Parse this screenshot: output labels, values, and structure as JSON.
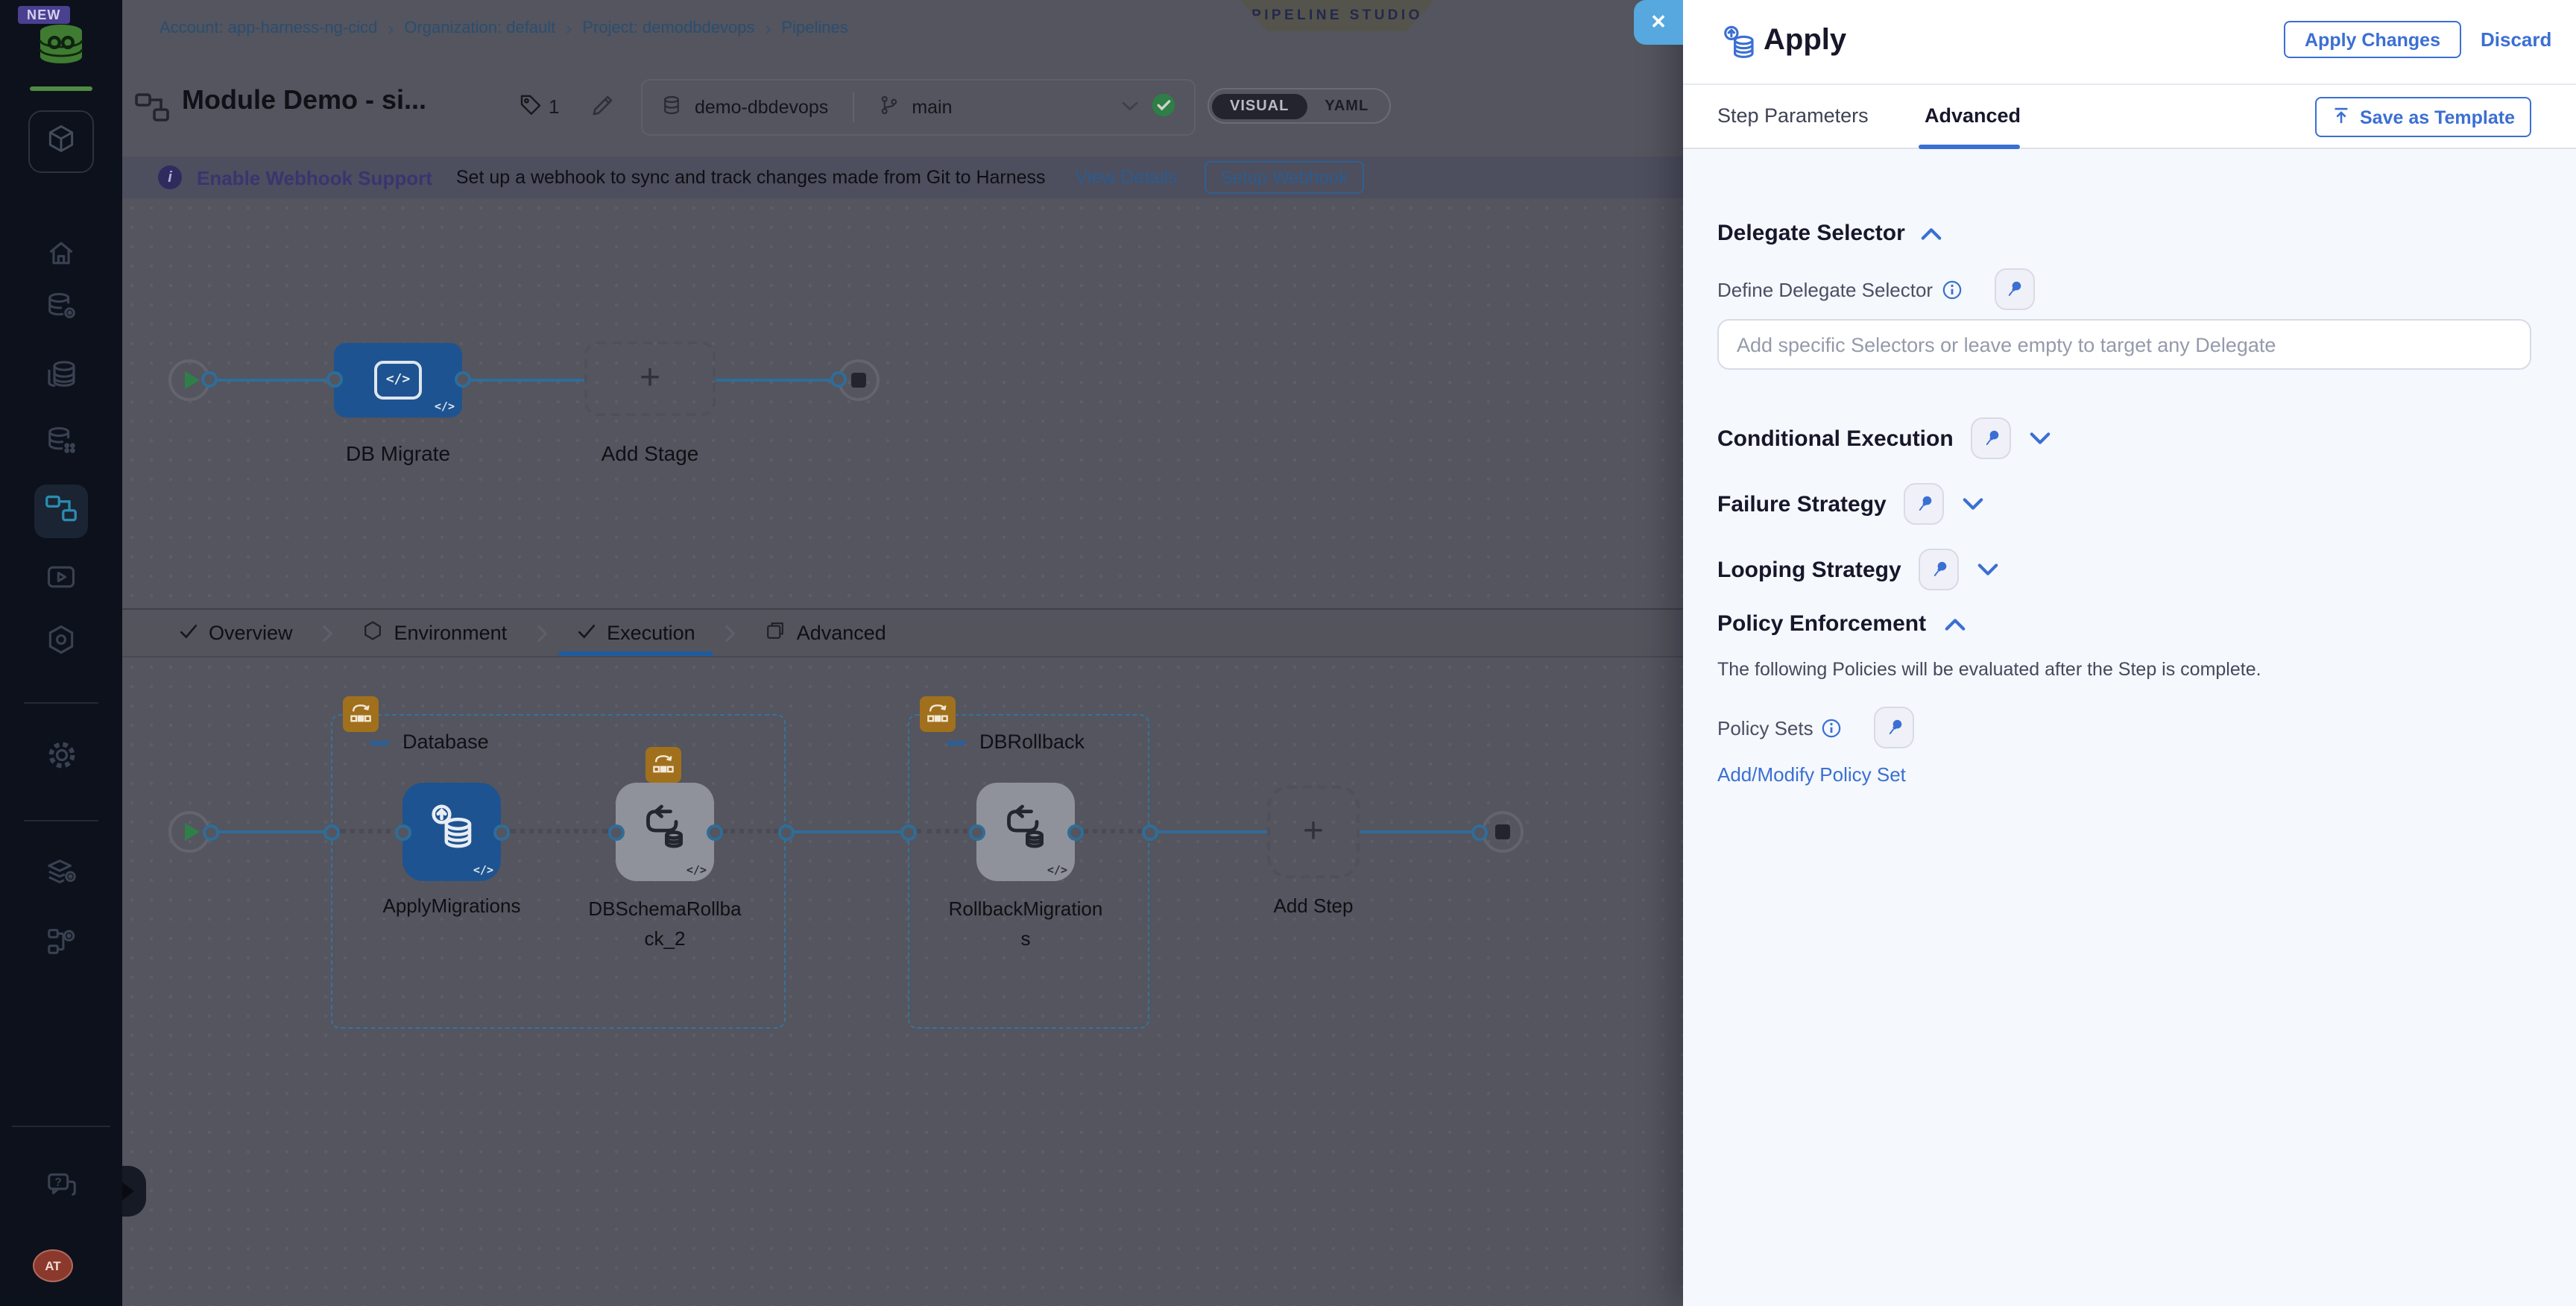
{
  "sidebar": {
    "new_badge": "NEW",
    "avatar_initials": "AT"
  },
  "breadcrumb": {
    "separator": "›",
    "items": [
      "Account: app-harness-ng-cicd",
      "Organization: default",
      "Project: demodbdevops",
      "Pipelines"
    ]
  },
  "ribbon": {
    "label": "PIPELINE STUDIO"
  },
  "pipeline_header": {
    "title": "Module Demo - si...",
    "tag_count": "1",
    "repo_name": "demo-dbdevops",
    "branch_name": "main",
    "toggle": {
      "visual": "VISUAL",
      "yaml": "YAML",
      "active": "VISUAL"
    }
  },
  "webhook_banner": {
    "info_glyph": "i",
    "title": "Enable Webhook Support",
    "message": "Set up a webhook to sync and track changes made from Git to Harness",
    "view_details": "View Details",
    "setup_button": "Setup Webhook"
  },
  "stage_graph": {
    "stage_name": "DB Migrate",
    "add_stage_label": "Add Stage",
    "plus": "+",
    "code_badge": "</>"
  },
  "stage_tabs": {
    "items": [
      {
        "label": "Overview",
        "icon": "check"
      },
      {
        "label": "Environment",
        "icon": "hexagon"
      },
      {
        "label": "Execution",
        "icon": "check",
        "active": true
      },
      {
        "label": "Advanced",
        "icon": "panel"
      }
    ]
  },
  "execution_graph": {
    "plus": "+",
    "code_badge": "</>",
    "add_step_label": "Add Step",
    "groups": [
      {
        "name": "Database",
        "steps": [
          {
            "name": "ApplyMigrations"
          },
          {
            "name": "DBSchemaRollback_2"
          }
        ]
      },
      {
        "name": "DBRollback",
        "steps": [
          {
            "name": "RollbackMigrations"
          }
        ]
      }
    ]
  },
  "drawer": {
    "close_glyph": "✕",
    "title": "Apply",
    "apply_button": "Apply Changes",
    "discard_button": "Discard",
    "tabs": {
      "step_parameters": "Step Parameters",
      "advanced": "Advanced"
    },
    "save_as_template": "Save as Template",
    "delegate": {
      "heading": "Delegate Selector",
      "label": "Define Delegate Selector",
      "placeholder": "Add specific Selectors or leave empty to target any Delegate"
    },
    "sections": {
      "conditional": "Conditional Execution",
      "failure": "Failure Strategy",
      "looping": "Looping Strategy"
    },
    "policy": {
      "heading": "Policy Enforcement",
      "description": "The following Policies will be evaluated after the Step is complete.",
      "label": "Policy Sets",
      "link": "Add/Modify Policy Set"
    }
  },
  "colors": {
    "accent_blue": "#3b6fd3",
    "node_blue": "#1d5391",
    "close_blue": "#56a8de",
    "success_green": "#2f7d47",
    "badge_orange": "#a1701c"
  }
}
